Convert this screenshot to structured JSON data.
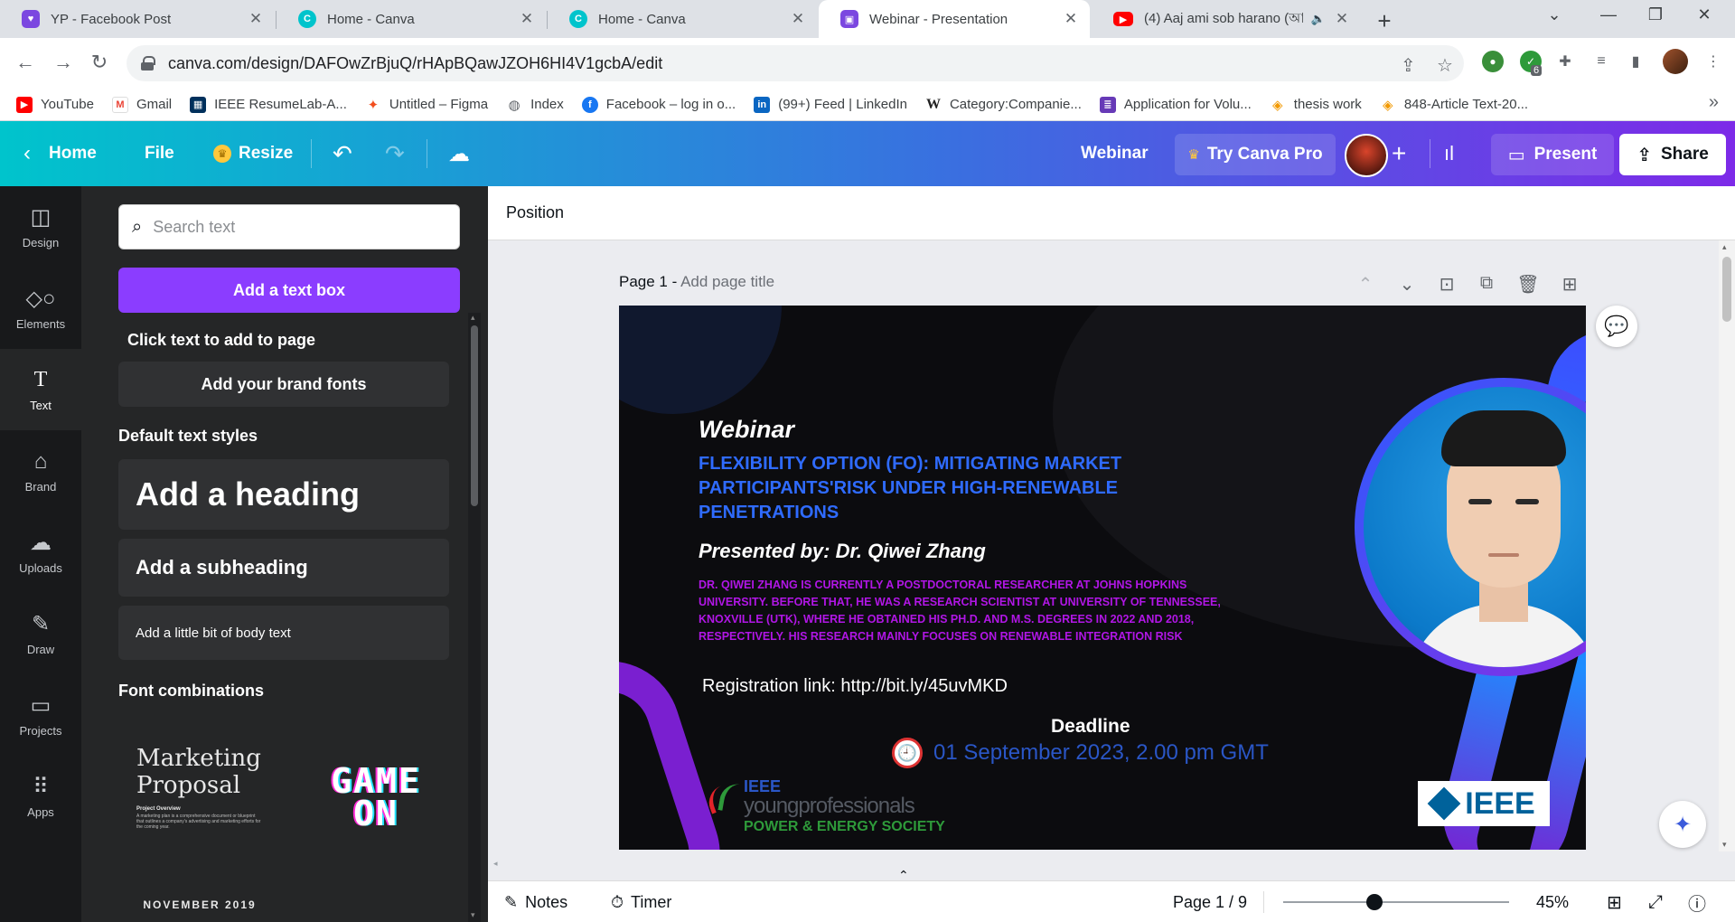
{
  "browser": {
    "tabs": [
      {
        "title": "YP - Facebook Post",
        "active": false
      },
      {
        "title": "Home - Canva",
        "active": false
      },
      {
        "title": "Home - Canva",
        "active": false
      },
      {
        "title": "Webinar - Presentation",
        "active": true
      },
      {
        "title": "(4) Aaj ami sob harano (আজ",
        "active": false
      }
    ],
    "url": "canva.com/design/DAFOwZrBjuQ/rHApBQawJZOH6HI4V1gcbA/edit",
    "extension_badge": "6",
    "bookmarks": [
      {
        "label": "YouTube",
        "icon": "youtube-icon",
        "color": "#ff0000"
      },
      {
        "label": "Gmail",
        "icon": "gmail-icon",
        "color": "#ea4335"
      },
      {
        "label": "IEEE ResumeLab-A...",
        "icon": "ieee-icon",
        "color": "#00305c"
      },
      {
        "label": "Untitled – Figma",
        "icon": "figma-icon",
        "color": "#f24e1e"
      },
      {
        "label": "Index",
        "icon": "globe-icon",
        "color": "#5f6368"
      },
      {
        "label": "Facebook – log in o...",
        "icon": "facebook-icon",
        "color": "#1877f2"
      },
      {
        "label": "(99+) Feed | LinkedIn",
        "icon": "linkedin-icon",
        "color": "#0a66c2"
      },
      {
        "label": "Category:Companie...",
        "icon": "wikipedia-icon",
        "color": "#222222"
      },
      {
        "label": "Application for Volu...",
        "icon": "form-icon",
        "color": "#673ab7"
      },
      {
        "label": "thesis work",
        "icon": "layers-icon",
        "color": "#f29900"
      },
      {
        "label": "848-Article Text-20...",
        "icon": "layers-icon",
        "color": "#f29900"
      }
    ]
  },
  "canva_header": {
    "home": "Home",
    "file": "File",
    "resize": "Resize",
    "design_name": "Webinar",
    "try_pro": "Try Canva Pro",
    "present": "Present",
    "share": "Share"
  },
  "rail": [
    {
      "label": "Design",
      "icon": "design-icon"
    },
    {
      "label": "Elements",
      "icon": "elements-icon"
    },
    {
      "label": "Text",
      "icon": "text-icon",
      "active": true
    },
    {
      "label": "Brand",
      "icon": "brand-icon"
    },
    {
      "label": "Uploads",
      "icon": "upload-cloud-icon"
    },
    {
      "label": "Draw",
      "icon": "draw-icon"
    },
    {
      "label": "Projects",
      "icon": "folder-icon"
    },
    {
      "label": "Apps",
      "icon": "apps-grid-icon"
    }
  ],
  "text_panel": {
    "search_placeholder": "Search text",
    "add_text_box": "Add a text box",
    "click_hint": "Click text to add to page",
    "brand_fonts": "Add your brand fonts",
    "default_styles": "Default text styles",
    "heading": "Add a heading",
    "subheading": "Add a subheading",
    "body": "Add a little bit of body text",
    "font_combinations": "Font combinations",
    "combo1_title": "Marketing Proposal",
    "combo1_sub": "Project Overview",
    "combo1_body": "A marketing plan is a comprehensive document or blueprint that outlines a company's advertising and marketing efforts for the coming year.",
    "combo2": "GAME ON",
    "combo3": "NOVEMBER 2019"
  },
  "editor": {
    "position_label": "Position",
    "page_label": "Page 1 -",
    "page_title_placeholder": "Add page title"
  },
  "slide": {
    "webinar": "Webinar",
    "title": "FLEXIBILITY OPTION (FO): MITIGATING MARKET PARTICIPANTS'RISK UNDER HIGH-RENEWABLE PENETRATIONS",
    "presented_by": "Presented by: Dr. Qiwei Zhang",
    "bio": "DR. QIWEI ZHANG IS CURRENTLY A POSTDOCTORAL RESEARCHER AT JOHNS HOPKINS UNIVERSITY. BEFORE THAT, HE WAS A RESEARCH SCIENTIST AT UNIVERSITY OF TENNESSEE, KNOXVILLE (UTK), WHERE HE OBTAINED HIS PH.D. AND M.S. DEGREES IN 2022 AND 2018, RESPECTIVELY. HIS RESEARCH MAINLY FOCUSES ON RENEWABLE INTEGRATION RISK",
    "registration": "Registration link: http://bit.ly/45uvMKD",
    "deadline_label": "Deadline",
    "deadline": "01 September 2023, 2.00 pm GMT",
    "yp_logo_line1": "IEEE",
    "yp_logo_line2": "youngprofessionals",
    "pes_line": "POWER & ENERGY SOCIETY",
    "ieee_logo": "IEEE",
    "colors": {
      "title": "#2f6bff",
      "bio": "#b116e6",
      "deadline": "#2a56c6",
      "pes": "#2e9a3a"
    }
  },
  "bottom_bar": {
    "notes": "Notes",
    "timer": "Timer",
    "page_counter": "Page 1 / 9",
    "zoom": "45%",
    "zoom_level": 0.45
  }
}
